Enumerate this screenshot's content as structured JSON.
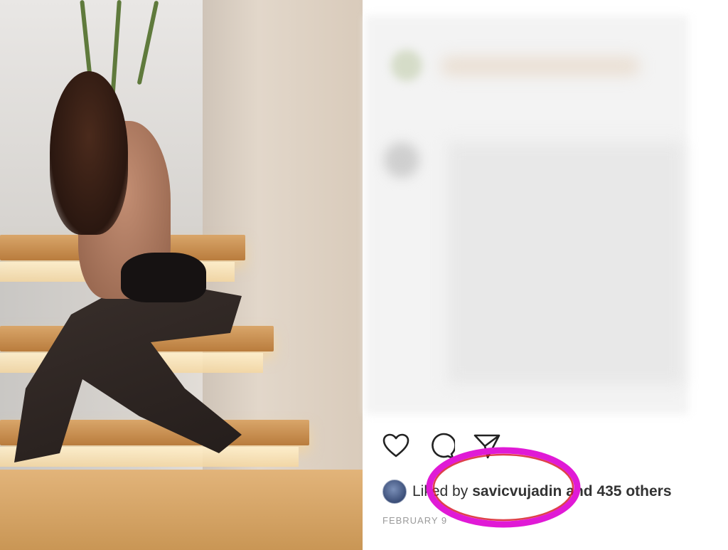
{
  "post": {
    "liked_prefix": "Liked by",
    "liked_user": "savicvujadin",
    "liked_suffix": "and 435 others",
    "date": "FEBRUARY 9"
  },
  "icons": {
    "like": "heart-icon",
    "comment": "comment-icon",
    "share": "send-icon"
  },
  "annotation": {
    "highlight_color": "#e01ad6",
    "highlight_inner": "#d8202a"
  },
  "colors": {
    "photo_warm": "#c99655",
    "text_dark": "#2f2f2f",
    "date_gray": "#9a9a9a"
  }
}
